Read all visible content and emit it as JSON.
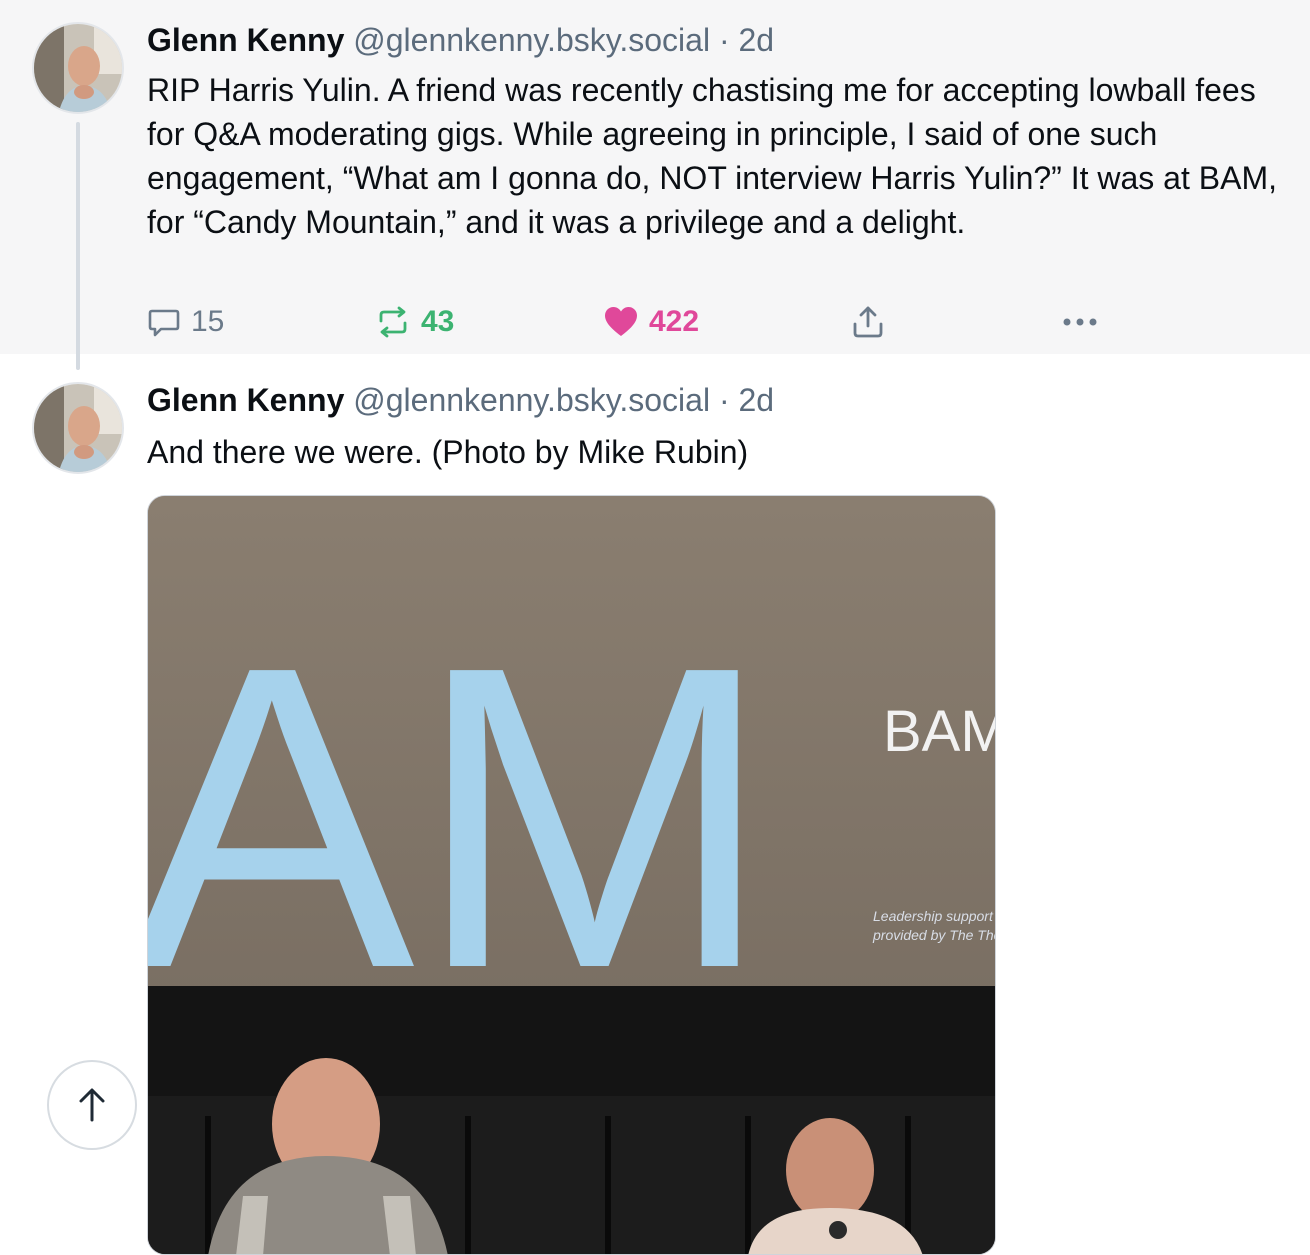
{
  "posts": [
    {
      "author_name": "Glenn Kenny",
      "handle": "@glennkenny.bsky.social",
      "separator": "·",
      "time": "2d",
      "text": "RIP Harris Yulin. A friend was recently chastising me for accepting lowball fees for Q&A moderating gigs. While agreeing in principle, I said of one such engagement, “What am I gonna do, NOT interview Harris Yulin?” It was at BAM, for “Candy Mountain,” and it was a privilege and a delight.",
      "replies": "15",
      "reposts": "43",
      "likes": "422"
    },
    {
      "author_name": "Glenn Kenny",
      "handle": "@glennkenny.bsky.social",
      "separator": "·",
      "time": "2d",
      "text": "And there we were. (Photo by Mike Rubin)",
      "image": {
        "screen_letters": "AM",
        "logo_text": "BAM",
        "small_text_line1": "Leadership support f",
        "small_text_line2": "provided by The Tho"
      }
    }
  ],
  "icons": {
    "reply": "speech-bubble-icon",
    "repost": "repost-arrows-icon",
    "like": "heart-icon",
    "share": "share-upload-icon",
    "more": "more-dots-icon",
    "scroll_top": "arrow-up-icon"
  },
  "colors": {
    "repost_active": "#3cb371",
    "like_active": "#e0489a",
    "muted": "#5b6b7c",
    "parent_bg": "#f6f6f7"
  }
}
